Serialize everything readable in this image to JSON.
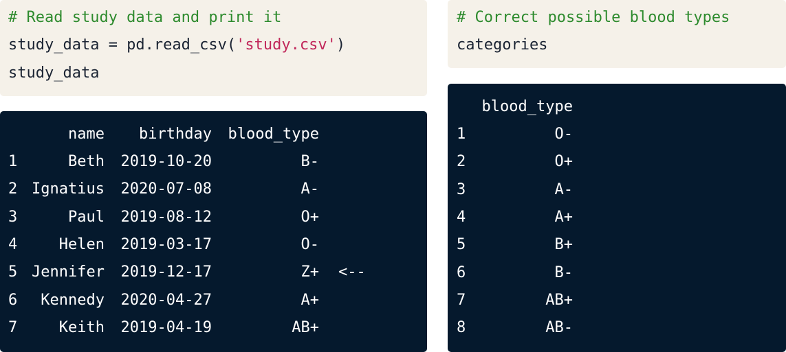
{
  "left_code": {
    "comment": "# Read study data and print it",
    "line2_prefix": "study_data = pd.read_csv(",
    "line2_string": "'study.csv'",
    "line2_suffix": ")",
    "line3": "study_data"
  },
  "right_code": {
    "comment": "# Correct possible blood types",
    "line2": "categories"
  },
  "left_output": {
    "headers": [
      "name",
      "birthday",
      "blood_type"
    ],
    "rows": [
      {
        "index": "1",
        "name": "Beth",
        "birthday": "2019-10-20",
        "blood_type": "B-",
        "marker": ""
      },
      {
        "index": "2",
        "name": "Ignatius",
        "birthday": "2020-07-08",
        "blood_type": "A-",
        "marker": ""
      },
      {
        "index": "3",
        "name": "Paul",
        "birthday": "2019-08-12",
        "blood_type": "O+",
        "marker": ""
      },
      {
        "index": "4",
        "name": "Helen",
        "birthday": "2019-03-17",
        "blood_type": "O-",
        "marker": ""
      },
      {
        "index": "5",
        "name": "Jennifer",
        "birthday": "2019-12-17",
        "blood_type": "Z+",
        "marker": "<--"
      },
      {
        "index": "6",
        "name": "Kennedy",
        "birthday": "2020-04-27",
        "blood_type": "A+",
        "marker": ""
      },
      {
        "index": "7",
        "name": "Keith",
        "birthday": "2019-04-19",
        "blood_type": "AB+",
        "marker": ""
      }
    ]
  },
  "right_output": {
    "header": "blood_type",
    "rows": [
      {
        "index": "1",
        "blood_type": "O-"
      },
      {
        "index": "2",
        "blood_type": "O+"
      },
      {
        "index": "3",
        "blood_type": "A-"
      },
      {
        "index": "4",
        "blood_type": "A+"
      },
      {
        "index": "5",
        "blood_type": "B+"
      },
      {
        "index": "6",
        "blood_type": "B-"
      },
      {
        "index": "7",
        "blood_type": "AB+"
      },
      {
        "index": "8",
        "blood_type": "AB-"
      }
    ]
  },
  "colors": {
    "code_bg": "#f5f1e9",
    "output_bg": "#05192d",
    "comment": "#2e8b2e",
    "string": "#c1275a"
  }
}
